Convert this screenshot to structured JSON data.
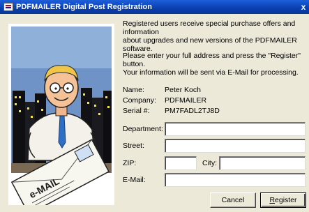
{
  "window": {
    "title": "PDFMAILER Digital Post Registration",
    "close_glyph": "x"
  },
  "intro": {
    "line1": "Registered users receive special purchase offers and information",
    "line2": "about upgrades and new versions of the PDFMAILER software.",
    "line3": "Please enter your full address and press the \"Register\" button.",
    "line4": "Your information will be sent via E-Mail for processing."
  },
  "info": {
    "name_label": "Name:",
    "name_value": "Peter Koch",
    "company_label": "Company:",
    "company_value": "PDFMAILER",
    "serial_label": "Serial #:",
    "serial_value": "PM7FADL2TJ8D"
  },
  "form": {
    "department_label": "Department:",
    "department_value": "",
    "street_label": "Street:",
    "street_value": "",
    "zip_label": "ZIP:",
    "zip_value": "",
    "city_label": "City:",
    "city_value": "",
    "email_label": "E-Mail:",
    "email_value": ""
  },
  "buttons": {
    "cancel": "Cancel",
    "register": "Register"
  },
  "art": {
    "envelope_text": "e-MAIL"
  }
}
